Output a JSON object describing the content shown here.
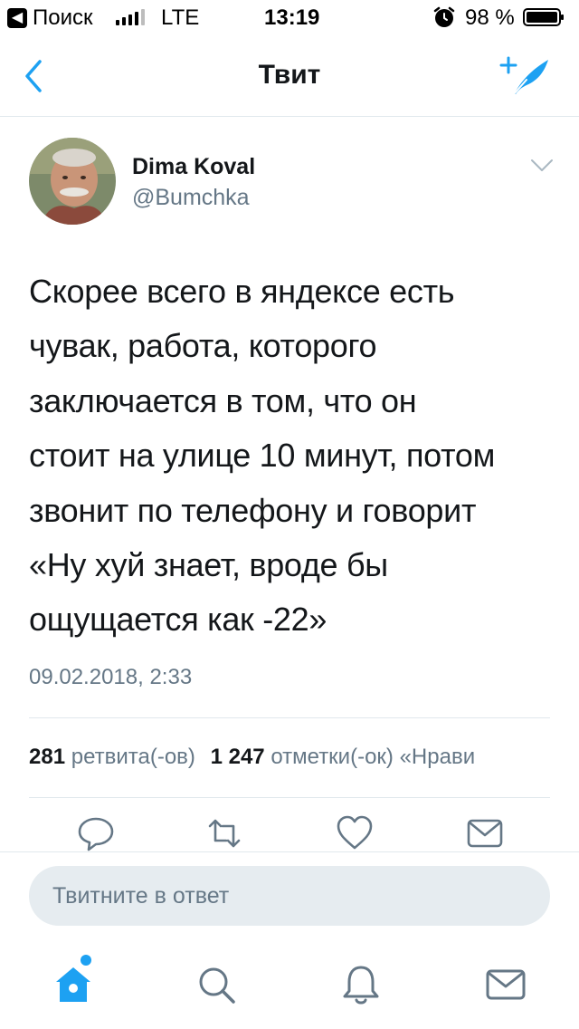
{
  "status_bar": {
    "back_app": "Поиск",
    "network": "LTE",
    "time": "13:19",
    "battery": "98 %"
  },
  "nav": {
    "title": "Твит"
  },
  "tweet": {
    "author_name": "Dima Koval",
    "author_handle": "@Bumchka",
    "text": "Скорее всего в яндексе есть\nчувак, работа, которого\nзаключается в том, что он\nстоит на улице 10 минут, потом\nзвонит по телефону и говорит\n«Ну хуй знает, вроде бы\nощущается как -22»",
    "date": "09.02.2018, 2:33"
  },
  "stats": {
    "retweets_count": "281",
    "retweets_label": "ретвита(-ов)",
    "likes_count": "1 247",
    "likes_label": "отметки(-ок) «Нрави"
  },
  "reply": {
    "placeholder": "Твитните в ответ"
  },
  "colors": {
    "accent": "#1da1f2",
    "text_primary": "#14171a",
    "text_secondary": "#657786",
    "divider": "#e1e8ed",
    "reply_bg": "#e6ecf0"
  },
  "icons": {
    "nav_back": "chevron-left-icon",
    "compose": "compose-tweet-icon",
    "more": "chevron-down-icon",
    "reply": "reply-icon",
    "retweet": "retweet-icon",
    "like": "heart-icon",
    "dm": "envelope-icon",
    "tab_home": "home-icon",
    "tab_search": "search-icon",
    "tab_notifications": "bell-icon",
    "tab_messages": "envelope-icon"
  }
}
